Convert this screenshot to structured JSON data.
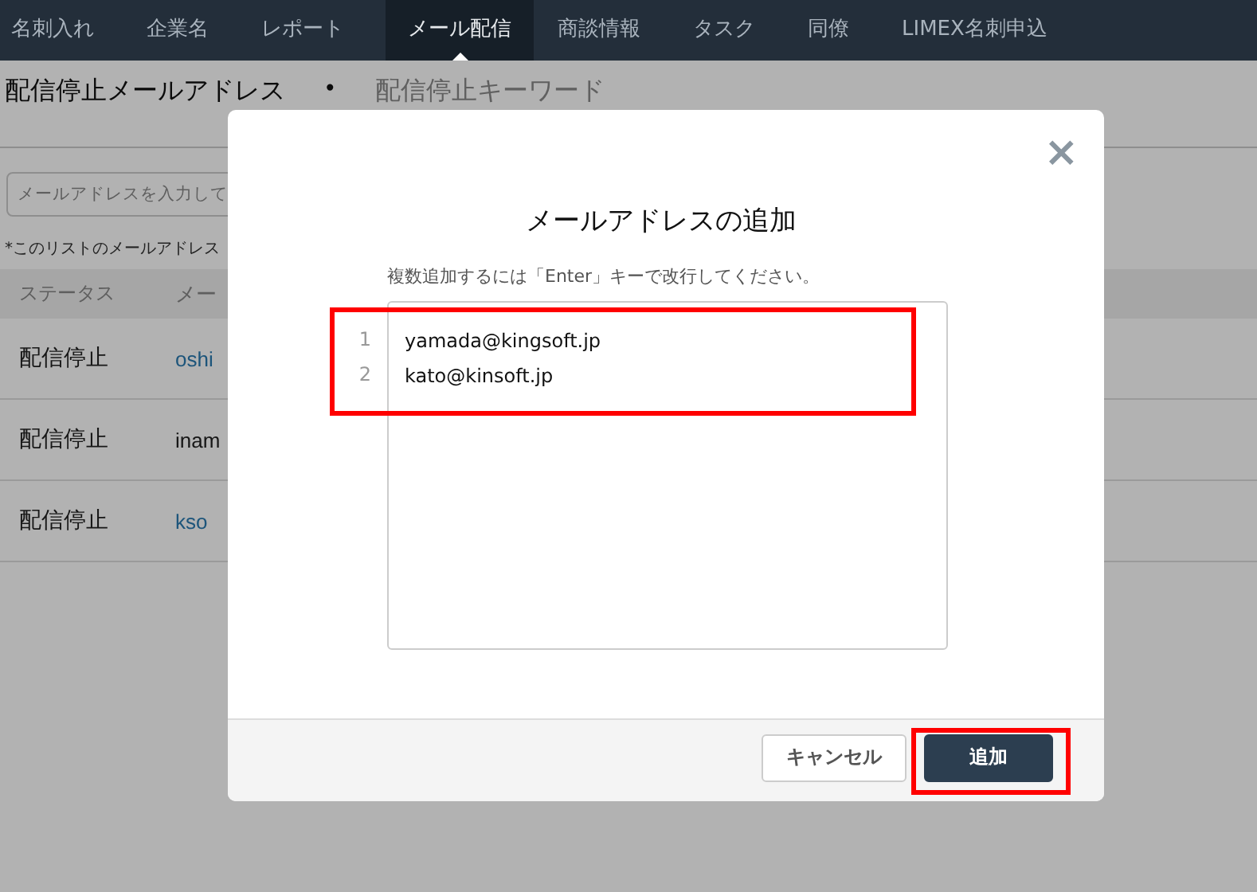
{
  "nav": {
    "items": [
      {
        "label": "名刺入れ",
        "selected": false
      },
      {
        "label": "企業名",
        "selected": false
      },
      {
        "label": "レポート",
        "selected": false
      },
      {
        "label": "メール配信",
        "selected": true
      },
      {
        "label": "商談情報",
        "selected": false
      },
      {
        "label": "タスク",
        "selected": false
      },
      {
        "label": "同僚",
        "selected": false
      },
      {
        "label": "LIMEX名刺申込",
        "selected": false
      }
    ]
  },
  "page_tabs": [
    {
      "label": "配信停止メールアドレス",
      "selected": true
    },
    {
      "label": "配信停止キーワード",
      "selected": false
    }
  ],
  "page_tab_separator": "•",
  "search": {
    "placeholder": "メールアドレスを入力して"
  },
  "note": "*このリストのメールアドレス",
  "table": {
    "columns": [
      "ステータス",
      "メー"
    ],
    "rows": [
      {
        "status": "配信停止",
        "email": "oshi",
        "link": true
      },
      {
        "status": "配信停止",
        "email": "inam",
        "link": false
      },
      {
        "status": "配信停止",
        "email": "kso",
        "link": true
      }
    ]
  },
  "dialog": {
    "title": "メールアドレスの追加",
    "hint": "複数追加するには「Enter」キーで改行してください。",
    "editor": {
      "highlighted": true,
      "lines": [
        {
          "number": "1",
          "text": "yamada@kingsoft.jp"
        },
        {
          "number": "2",
          "text": "kato@kinsoft.jp"
        }
      ]
    },
    "close": "×",
    "buttons": [
      {
        "label": "キャンセル",
        "kind": "secondary",
        "highlighted": false
      },
      {
        "label": "追加",
        "kind": "primary",
        "highlighted": true
      }
    ]
  }
}
